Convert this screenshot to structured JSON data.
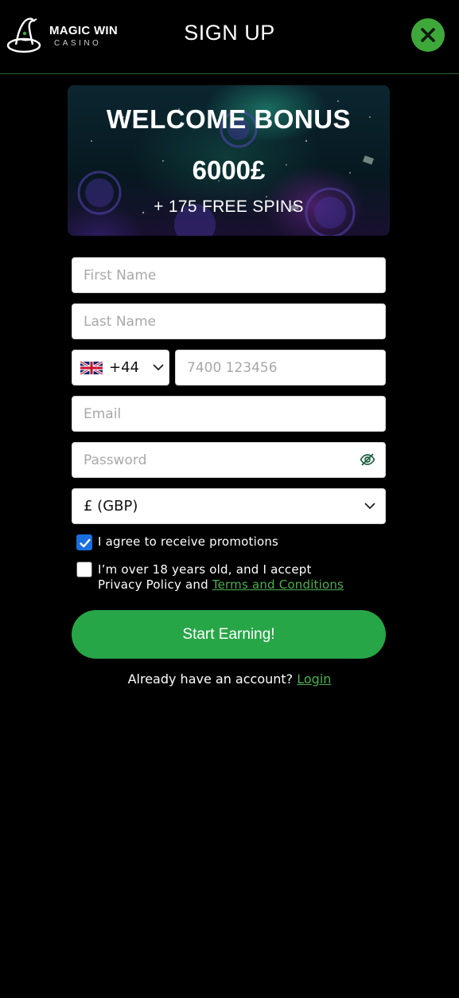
{
  "header": {
    "logo_name": "MAGIC WIN",
    "logo_sub": "CASINO",
    "title": "SIGN UP",
    "close_icon": "close-icon"
  },
  "banner": {
    "title": "WELCOME BONUS",
    "amount": "6000£",
    "spins": "+ 175 FREE SPINS"
  },
  "form": {
    "first_name_placeholder": "First Name",
    "last_name_placeholder": "Last Name",
    "country_flag": "uk-flag-icon",
    "dial_code": "+44",
    "phone_placeholder": "7400 123456",
    "email_placeholder": "Email",
    "password_placeholder": "Password",
    "currency": "£ (GBP)",
    "promotions_checked": true,
    "promotions_label": "I agree to receive promotions",
    "terms_checked": false,
    "terms_label_line1": "I’m over 18 years old, and I accept",
    "terms_label_prefix": "Privacy Policy and ",
    "terms_link": "Terms and Conditions",
    "submit_label": "Start Earning!",
    "login_prompt": "Already have an account? ",
    "login_link": "Login"
  },
  "colors": {
    "accent_green": "#27a647",
    "close_green": "#3fa83a",
    "link_green": "#4caf50",
    "checkbox_blue": "#1a6fe0",
    "background": "#000000"
  }
}
